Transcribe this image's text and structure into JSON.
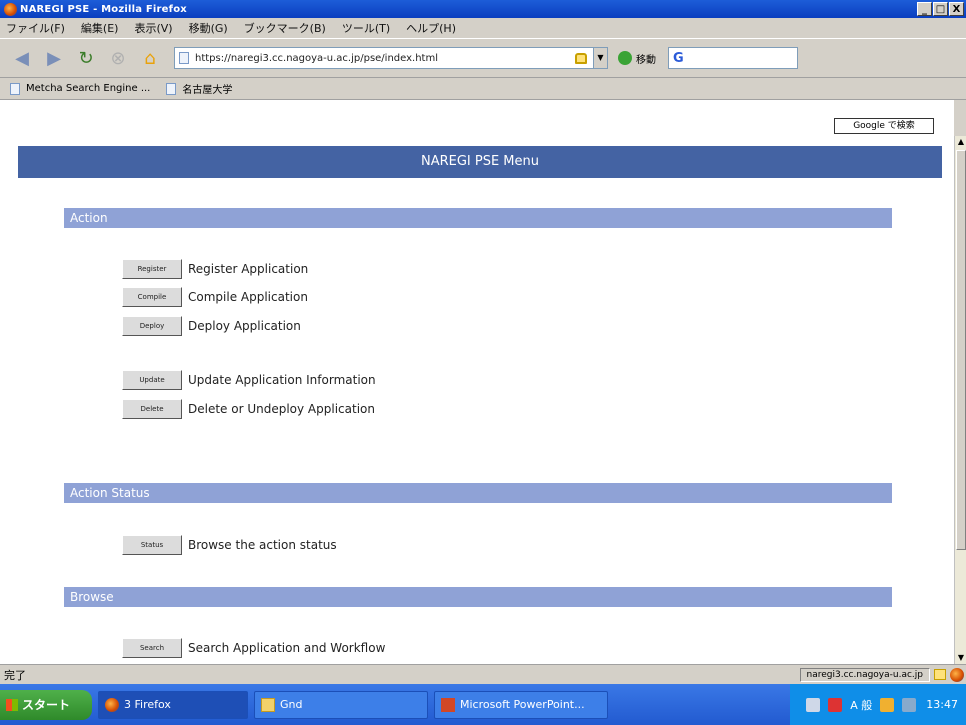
{
  "window": {
    "title": "NAREGI PSE - Mozilla Firefox",
    "buttons": [
      "_",
      "□",
      "X"
    ]
  },
  "menu": [
    "ファイル(F)",
    "編集(E)",
    "表示(V)",
    "移動(G)",
    "ブックマーク(B)",
    "ツール(T)",
    "ヘルプ(H)"
  ],
  "nav": {
    "url": "https://naregi3.cc.nagoya-u.ac.jp/pse/index.html",
    "go_label": "移動",
    "search_placeholder": "G"
  },
  "bookmarks": [
    "Metcha Search Engine ...",
    "名古屋大学"
  ],
  "google_search_button": "Google で検索",
  "page": {
    "header": "NAREGI PSE Menu",
    "sections": {
      "action": "Action",
      "action_status": "Action Status",
      "browse": "Browse"
    },
    "actions": [
      {
        "button": "Register",
        "label": "Register Application"
      },
      {
        "button": "Compile",
        "label": "Compile Application"
      },
      {
        "button": "Deploy",
        "label": "Deploy Application"
      },
      {
        "button": "Update",
        "label": "Update Application Information"
      },
      {
        "button": "Delete",
        "label": "Delete or Undeploy Application"
      }
    ],
    "status_action": {
      "button": "Status",
      "label": "Browse the action status"
    },
    "browse_action": {
      "button": "Search",
      "label": "Search Application and Workflow"
    }
  },
  "statusbar": {
    "text": "完了",
    "host": "naregi3.cc.nagoya-u.ac.jp"
  },
  "taskbar": {
    "start": "スタート",
    "tasks": [
      "3 Firefox",
      "Gnd",
      "Microsoft PowerPoint..."
    ],
    "clock": "13:47",
    "ime": "A 般"
  }
}
